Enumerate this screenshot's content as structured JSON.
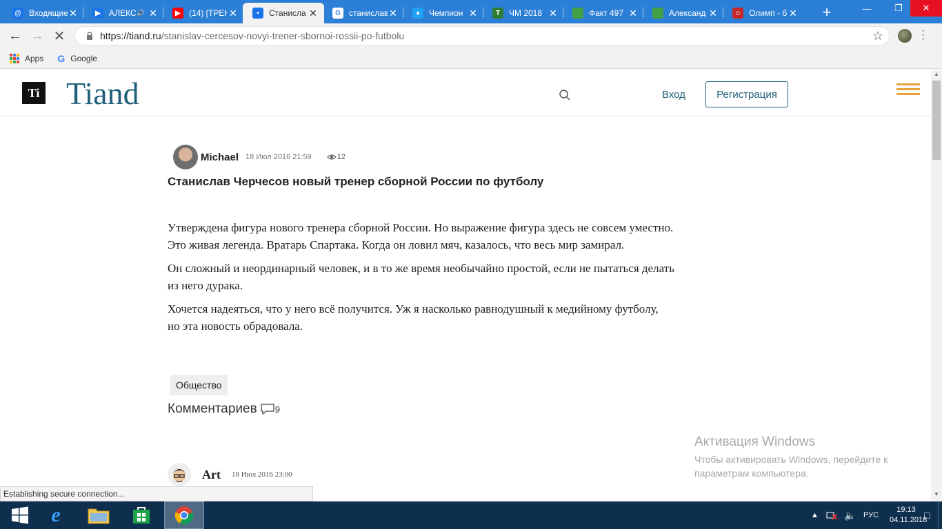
{
  "browser": {
    "tabs": [
      {
        "title": "Входящие",
        "color": "#1a73e8",
        "glyph": "@"
      },
      {
        "title": "АЛЕКС",
        "color": "#1a73e8",
        "glyph": "▶",
        "audio": "🔊"
      },
      {
        "title": "(14) [ТРЕН",
        "color": "#ff0000",
        "glyph": "▶"
      },
      {
        "title": "Станисла",
        "color": "#1a73e8",
        "glyph": "•",
        "active": true
      },
      {
        "title": "станислав",
        "color": "#ffffff",
        "glyph": "G"
      },
      {
        "title": "Чемпион",
        "color": "#1da1f2",
        "glyph": "♦"
      },
      {
        "title": "ЧМ 2018",
        "color": "#2e7d32",
        "glyph": "T"
      },
      {
        "title": "Факт 497",
        "color": "#43a047",
        "glyph": ""
      },
      {
        "title": "Александ",
        "color": "#43a047",
        "glyph": ""
      },
      {
        "title": "Олимп - б",
        "color": "#c62828",
        "glyph": "☺"
      }
    ],
    "tab_close": "✕",
    "new_tab": "+",
    "url_host": "https://tiand.ru",
    "url_path": "/stanislav-cercesov-novyi-trener-sbornoi-rossii-po-futbolu",
    "bookmarks": [
      {
        "label": "Apps"
      },
      {
        "label": "Google"
      }
    ],
    "status": "Establishing secure connection..."
  },
  "site": {
    "logo_mark": "Ti",
    "logo_text": "Tiand",
    "login": "Вход",
    "register": "Регистрация",
    "accent": "#e8a23b",
    "brand": "#1f5f7a"
  },
  "article": {
    "author": "Michael",
    "date": "18 Июл 2016 21:59",
    "views": "12",
    "title": "Станислав Черчесов новый тренер сборной России по футболу",
    "paragraphs": [
      [
        "Утверждена фигура нового тренера сборной России. Но выражение фигура здесь не совсем уместно.",
        "Это живая легенда. Вратарь Спартака. Когда он ловил мяч, казалось, что весь мир замирал."
      ],
      [
        "Он сложный и неординарный человек, и в то же время необычайно простой, если не пытаться делать",
        "из него дурака."
      ],
      [
        "Хочется надеяться, что у него всё получится. Уж я насколько равнодушный к медийному футболу,",
        "но эта новость обрадовала."
      ]
    ],
    "tag": "Общество",
    "comments_label": "Комментариев",
    "comments_count": "9"
  },
  "comment": {
    "author": "Art",
    "date": "18 Июл 2016 23:00"
  },
  "windows": {
    "activation_title": "Активация Windows",
    "activation_text_1": "Чтобы активировать Windows, перейдите к",
    "activation_text_2": "параметрам компьютера.",
    "lang": "РУС",
    "time": "19:13",
    "date": "04.11.2018"
  }
}
